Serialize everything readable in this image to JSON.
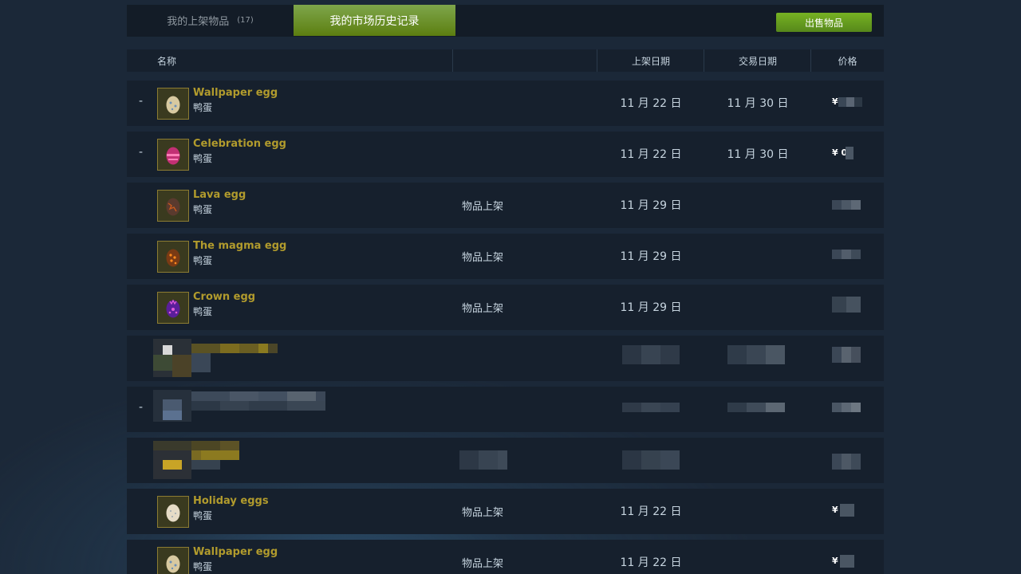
{
  "tabs": {
    "my_listings_label": "我的上架物品",
    "my_listings_count": "(17)",
    "history_label": "我的市场历史记录",
    "sell_button": "出售物品"
  },
  "header": {
    "name": "名称",
    "listed_date": "上架日期",
    "traded_date": "交易日期",
    "price": "价格"
  },
  "rows": [
    {
      "gain": "-",
      "name": "Wallpaper egg",
      "game": "鸭蛋",
      "action": "",
      "listed": "11 月 22 日",
      "traded": "11 月 30 日",
      "price": "¥",
      "egg_color": "#d8c9a0",
      "egg_accent": "#6a8fb8"
    },
    {
      "gain": "-",
      "name": "Celebration egg",
      "game": "鸭蛋",
      "action": "",
      "listed": "11 月 22 日",
      "traded": "11 月 30 日",
      "price": "¥ 0",
      "egg_color": "#c23074",
      "egg_accent": "#ff7fb8"
    },
    {
      "gain": "",
      "name": "Lava egg",
      "game": "鸭蛋",
      "action": "物品上架",
      "listed": "11 月 29 日",
      "traded": "",
      "price": "",
      "egg_color": "#5a3a2e",
      "egg_accent": "#c85a1e"
    },
    {
      "gain": "",
      "name": "The magma egg",
      "game": "鸭蛋",
      "action": "物品上架",
      "listed": "11 月 29 日",
      "traded": "",
      "price": "",
      "egg_color": "#7a3a14",
      "egg_accent": "#ff8a1e"
    },
    {
      "gain": "",
      "name": "Crown egg",
      "game": "鸭蛋",
      "action": "物品上架",
      "listed": "11 月 29 日",
      "traded": "",
      "price": "",
      "egg_color": "#5a1e9a",
      "egg_accent": "#e05ad8"
    },
    {
      "gain": "",
      "name": "",
      "game": "",
      "action": "",
      "listed": "",
      "traded": "",
      "price": ""
    },
    {
      "gain": "-",
      "name": "",
      "game": "",
      "action": "",
      "listed": "",
      "traded": "",
      "price": ""
    },
    {
      "gain": "",
      "name": "",
      "game": "",
      "action": "",
      "listed": "",
      "traded": "",
      "price": ""
    },
    {
      "gain": "",
      "name": "Holiday eggs",
      "game": "鸭蛋",
      "action": "物品上架",
      "listed": "11 月 22 日",
      "traded": "",
      "price": "¥",
      "egg_color": "#e6dcc6",
      "egg_accent": "#9aa6b0"
    },
    {
      "gain": "",
      "name": "Wallpaper egg",
      "game": "鸭蛋",
      "action": "物品上架",
      "listed": "11 月 22 日",
      "traded": "",
      "price": "¥",
      "egg_color": "#d8c9a0",
      "egg_accent": "#6a8fb8"
    }
  ]
}
